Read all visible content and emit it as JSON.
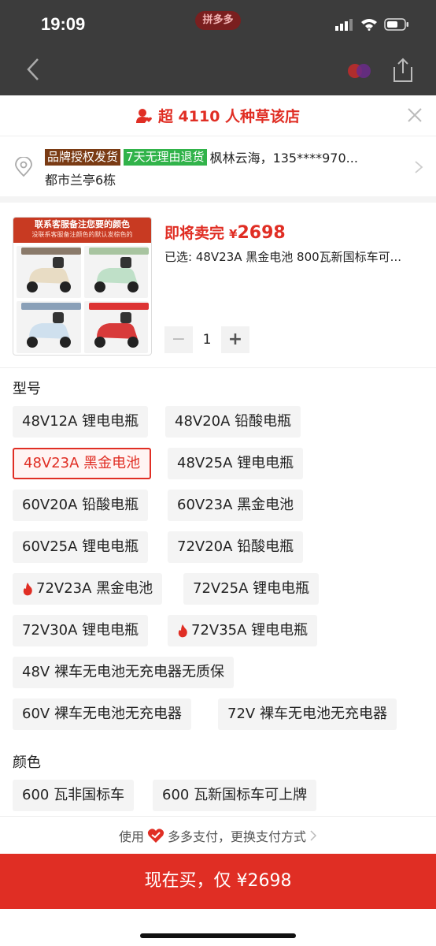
{
  "status_bar": {
    "time": "19:09",
    "center_label": "拼多多"
  },
  "sheet": {
    "promo": "超 4110 人种草该店",
    "address": {
      "badge_brand": "品牌授权发货",
      "badge_return": "7天无理由退货",
      "name_phone": "枫林云海，135****970...",
      "detail": "都市兰亭6栋"
    },
    "product": {
      "thumb_title": "联系客服备注您要的颜色",
      "thumb_subtitle": "没联系客服备注颜色的默认发棕色的",
      "selling_tag": "即将卖完",
      "price_symbol": "¥",
      "price": "2698",
      "selected": "已选: 48V23A 黑金电池 800瓦新国标车可...",
      "quantity": "1"
    },
    "model_title": "型号",
    "models": [
      "48V12A 锂电电瓶",
      "48V20A 铅酸电瓶",
      "48V23A 黑金电池",
      "48V25A 锂电电瓶",
      "60V20A 铅酸电瓶",
      "60V23A 黑金电池",
      "60V25A 锂电电瓶",
      "72V20A 铅酸电瓶",
      "72V23A 黑金电池",
      "72V25A 锂电电瓶",
      "72V30A 锂电电瓶",
      "72V35A 锂电电瓶",
      "48V 裸车无电池无充电器无质保",
      "60V 裸车无电池无充电器",
      "72V 裸车无电池无充电器"
    ],
    "selected_model_index": 2,
    "hot_model_indices": [
      8,
      11
    ],
    "color_title": "颜色",
    "colors": [
      "600 瓦非国标车",
      "600 瓦新国标车可上牌"
    ],
    "pay": {
      "prefix": "使用",
      "method": "多多支付，更换支付方式"
    },
    "buy_button": "现在买，仅 ¥2698"
  },
  "colors_theme": {
    "accent": "#e02e24",
    "return_badge": "#31b34a",
    "brand_badge": "#7a3b14"
  }
}
